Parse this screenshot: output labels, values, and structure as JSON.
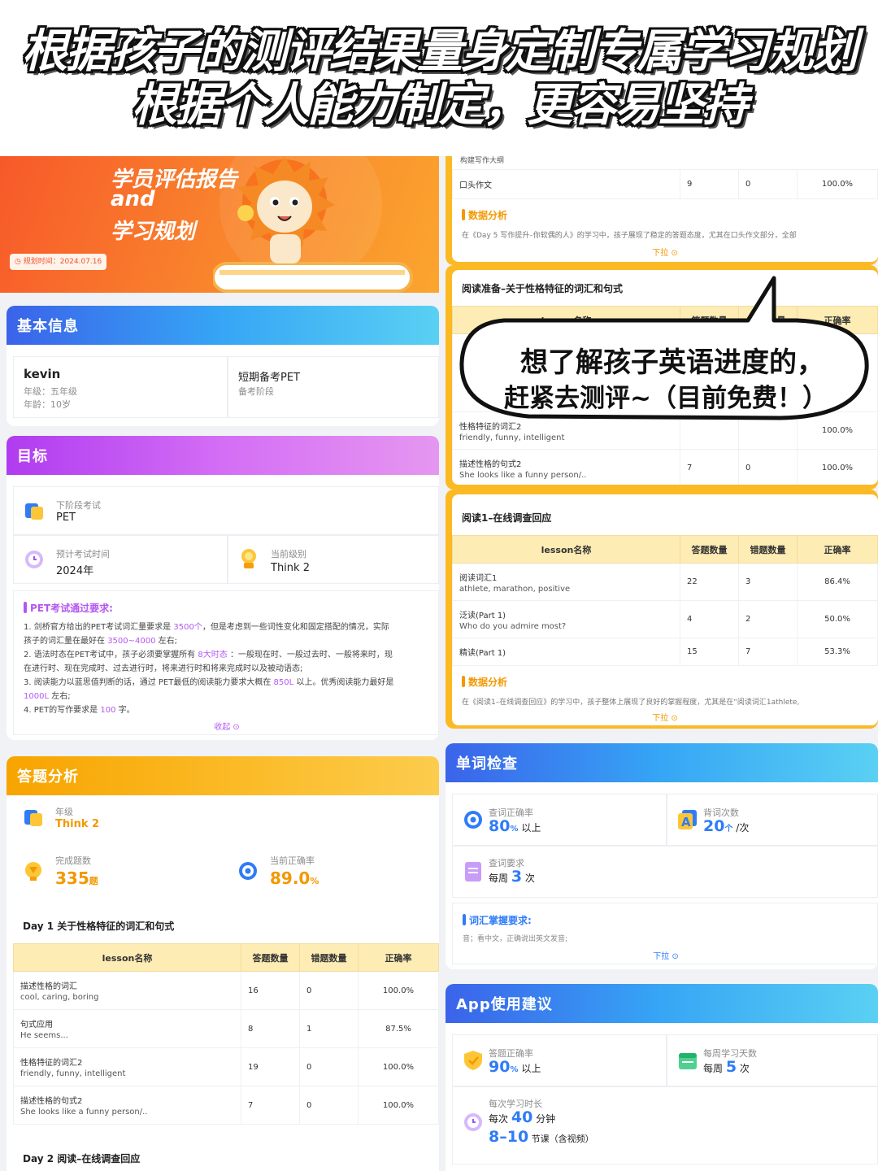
{
  "headline": {
    "line1": "根据孩子的测评结果量身定制专属学习规划",
    "line2": "根据个人能力制定，更容易坚持"
  },
  "banner": {
    "title1": "学员评估报告",
    "title2": "and",
    "title3": "学习规划",
    "date": "规划时间：2024.07.16"
  },
  "basic": {
    "title": "基本信息",
    "name": "kevin",
    "grade": "年级：五年级",
    "age": "年龄：10岁",
    "goal": "短期备考PET",
    "stage": "备考阶段"
  },
  "target": {
    "title": "目标",
    "next_label": "下阶段考试",
    "next_val": "PET",
    "time_label": "预计考试时间",
    "time_val": "2024年",
    "level_label": "当前级别",
    "level_val": "Think 2",
    "req_title": "PET考试通过要求:",
    "r1a": "1. 剑桥官方给出的PET考试词汇量要求是",
    "r1b": "3500个",
    "r1c": "，但是考虑到一些词性变化和固定搭配的情况，实际",
    "r1d": "孩子的词汇量在最好在",
    "r1e": "3500~4000",
    "r1f": "左右;",
    "r2a": "2. 语法时态在PET考试中，孩子必须要掌握所有",
    "r2b": "8大时态",
    "r2c": "：一般现在时、一般过去时、一般将来时，现",
    "r2d": "在进行时、现在完成时、过去进行时，将来进行时和将来完成时以及被动语态;",
    "r3a": "3. 阅读能力以蓝思值判断的话，通过 PET最低的阅读能力要求大概在",
    "r3b": "850L",
    "r3c": "以上。优秀阅读能力最好是",
    "r3d": "1000L",
    "r3e": "左右;",
    "r4a": "4. PET的写作要求是",
    "r4b": "100",
    "r4c": "字。",
    "collapse": "收起 ⊙"
  },
  "analysis": {
    "title": "答题分析",
    "grade_label": "年级",
    "grade_val": "Think 2",
    "done_label": "完成题数",
    "done_val": "335",
    "done_unit": "题",
    "rate_label": "当前正确率",
    "rate_val": "89.0",
    "rate_unit": "%"
  },
  "day1": {
    "title": "Day 1 关于性格特征的词汇和句式",
    "cols": [
      "lesson名称",
      "答题数量",
      "错题数量",
      "正确率"
    ],
    "rows": [
      {
        "t": "描述性格的词汇",
        "s": "cool, caring, boring",
        "a": "16",
        "e": "0",
        "r": "100.0%"
      },
      {
        "t": "句式应用",
        "s": "He seems...",
        "a": "8",
        "e": "1",
        "r": "87.5%"
      },
      {
        "t": "性格特征的词汇2",
        "s": "friendly, funny, intelligent",
        "a": "19",
        "e": "0",
        "r": "100.0%"
      },
      {
        "t": "描述性格的句式2",
        "s": "She looks like a funny person/..",
        "a": "7",
        "e": "0",
        "r": "100.0%"
      }
    ]
  },
  "day2": {
    "title": "Day 2 阅读–在线调查回应"
  },
  "rtop": {
    "row0": "构建写作大纲",
    "row1": {
      "t": "口头作文",
      "a": "9",
      "e": "0",
      "r": "100.0%"
    },
    "an_title": "数据分析",
    "an_text": "在《Day 5 写作提升–你软偶的人》的学习中，孩子展现了稳定的答题态度，尤其在口头作文部分，全部",
    "more": "下拉 ⊙"
  },
  "rd": {
    "title": "阅读准备–关于性格特征的词汇和句式",
    "cols": [
      "lesson名称",
      "答题数量",
      "错题数量",
      "正确率"
    ],
    "r3t": "性格特征的词汇2",
    "r3s": "friendly, funny, intelligent",
    "r3r": "100.0%",
    "r4": {
      "t": "描述性格的句式2",
      "s": "She looks like a funny person/..",
      "a": "7",
      "e": "0",
      "r": "100.0%"
    }
  },
  "bubble": {
    "l1": "想了解孩子英语进度的，",
    "l2": "赶紧去测评~（目前免费！）"
  },
  "r1": {
    "title": "阅读1–在线调查回应",
    "cols": [
      "lesson名称",
      "答题数量",
      "错题数量",
      "正确率"
    ],
    "rows": [
      {
        "t": "阅读词汇1",
        "s": "athlete, marathon, positive",
        "a": "22",
        "e": "3",
        "r": "86.4%"
      },
      {
        "t": "泛读(Part 1)",
        "s": "Who do you admire most?",
        "a": "4",
        "e": "2",
        "r": "50.0%"
      },
      {
        "t": "精读(Part 1)",
        "s": "",
        "a": "15",
        "e": "7",
        "r": "53.3%"
      }
    ],
    "an_title": "数据分析",
    "an_text": "在《阅读1–在线调查回应》的学习中，孩子整体上展现了良好的掌握程度，尤其是在“阅读词汇1athlete,",
    "more": "下拉 ⊙"
  },
  "words": {
    "title": "单词检查",
    "acc_label": "查词正确率",
    "acc_val": "80",
    "acc_unit": "%",
    "acc_suf": "以上",
    "rec_label": "背词次数",
    "rec_val": "20",
    "rec_unit": "个",
    "rec_suf": "/次",
    "req_label": "查词要求",
    "req_pre": "每周",
    "req_val": "3",
    "req_suf": "次",
    "m_title": "词汇掌握要求:",
    "m_text": "音；看中文，正确说出英文发音;",
    "more": "下拉 ⊙"
  },
  "app": {
    "title": "App使用建议",
    "a_label": "答题正确率",
    "a_val": "90",
    "a_unit": "%",
    "a_suf": "以上",
    "d_label": "每周学习天数",
    "d_pre": "每周",
    "d_val": "5",
    "d_suf": "次",
    "t_label": "每次学习时长",
    "t_pre": "每次",
    "t_val": "40",
    "t_suf": "分钟",
    "t2_val": "8–10",
    "t2_suf": "节课（含视频）"
  },
  "colors": {
    "orange": "#f39800",
    "blue": "#2f7cf6",
    "purple": "#b357f0"
  }
}
